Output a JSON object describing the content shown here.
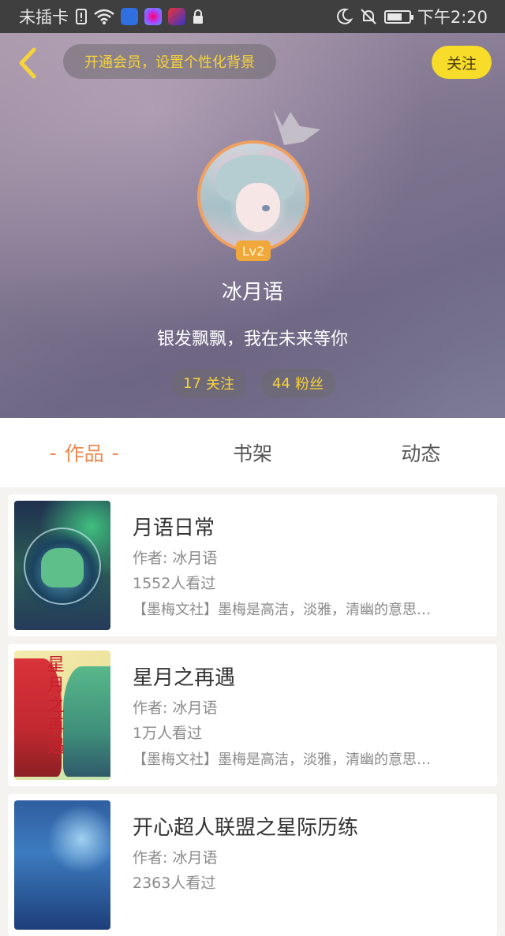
{
  "status_bar": {
    "carrier": "未插卡",
    "time": "下午2:20"
  },
  "header": {
    "vip_banner": "开通会员，设置个性化背景",
    "follow_label": "关注",
    "level": "Lv2",
    "nickname": "冰月语",
    "signature": "银发飘飘，我在未来等你",
    "following_count": "17",
    "following_label": "关注",
    "fans_count": "44",
    "fans_label": "粉丝",
    "accent_color": "#f7d43a"
  },
  "tabs": [
    {
      "label": "作品",
      "active": true
    },
    {
      "label": "书架",
      "active": false
    },
    {
      "label": "动态",
      "active": false
    }
  ],
  "tab_active_decoration": "-",
  "books": [
    {
      "title": "月语日常",
      "author": "作者: 冰月语",
      "views": "1552人看过",
      "desc": "【墨梅文社】墨梅是高洁，淡雅，清幽的意思…"
    },
    {
      "title": "星月之再遇",
      "author": "作者: 冰月语",
      "views": "1万人看过",
      "desc": "【墨梅文社】墨梅是高洁，淡雅，清幽的意思…",
      "cover_text": "星月之再遇"
    },
    {
      "title": "开心超人联盟之星际历练",
      "author": "作者: 冰月语",
      "views": "2363人看过",
      "desc": ""
    }
  ]
}
